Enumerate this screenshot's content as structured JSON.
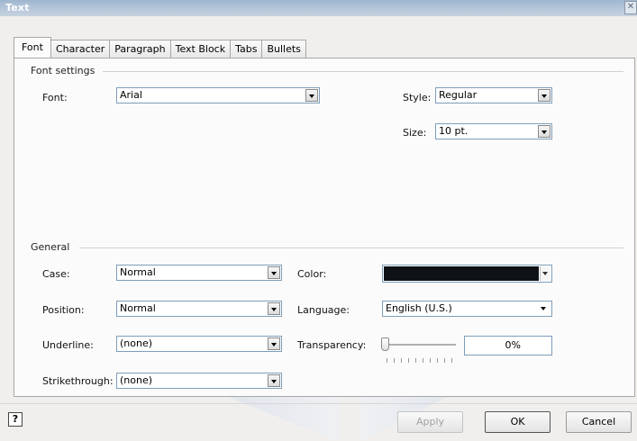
{
  "window": {
    "title": "Text",
    "close_glyph": "✕"
  },
  "watermark": {
    "text": "DropBooks"
  },
  "tabs": [
    {
      "label": "Font",
      "active": true
    },
    {
      "label": "Character",
      "active": false
    },
    {
      "label": "Paragraph",
      "active": false
    },
    {
      "label": "Text Block",
      "active": false
    },
    {
      "label": "Tabs",
      "active": false
    },
    {
      "label": "Bullets",
      "active": false
    }
  ],
  "font_settings": {
    "group_label": "Font settings",
    "font_label": "Font:",
    "font_value": "Arial",
    "style_label": "Style:",
    "style_value": "Regular",
    "size_label": "Size:",
    "size_value": "10 pt."
  },
  "general": {
    "group_label": "General",
    "case_label": "Case:",
    "case_value": "Normal",
    "position_label": "Position:",
    "position_value": "Normal",
    "underline_label": "Underline:",
    "underline_value": "(none)",
    "strikethrough_label": "Strikethrough:",
    "strikethrough_value": "(none)",
    "color_label": "Color:",
    "color_value": "#0e1216",
    "language_label": "Language:",
    "language_value": "English (U.S.)",
    "transparency_label": "Transparency:",
    "transparency_value": "0%",
    "transparency_level": 0
  },
  "footer": {
    "help_glyph": "?",
    "apply_label": "Apply",
    "ok_label": "OK",
    "cancel_label": "Cancel"
  }
}
